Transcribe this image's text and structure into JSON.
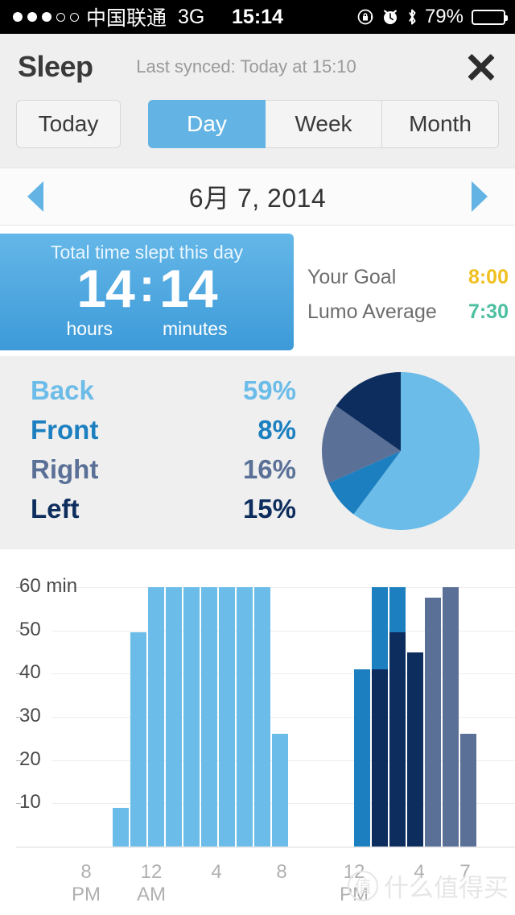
{
  "status_bar": {
    "signal_filled": 3,
    "signal_empty": 2,
    "carrier": "中国联通",
    "network": "3G",
    "time": "15:14",
    "battery_percent": "79%",
    "battery_level": 79,
    "icons": [
      "rotation-lock-icon",
      "alarm-clock-icon",
      "bluetooth-icon",
      "battery-icon"
    ]
  },
  "header": {
    "title": "Sleep",
    "last_synced": "Last synced: Today at 15:10",
    "close_label": "close-icon"
  },
  "tabs": {
    "today": "Today",
    "segments": [
      {
        "label": "Day",
        "active": true
      },
      {
        "label": "Week",
        "active": false
      },
      {
        "label": "Month",
        "active": false
      }
    ]
  },
  "date_nav": {
    "prev": "previous-day",
    "date": "6月 7, 2014",
    "next": "next-day"
  },
  "total_card": {
    "caption": "Total time slept this day",
    "hours": "14",
    "colon": ":",
    "minutes": "14",
    "hours_unit": "hours",
    "minutes_unit": "minutes"
  },
  "goals": [
    {
      "label": "Your Goal",
      "value": "8:00",
      "color": "#f0c020"
    },
    {
      "label": "Lumo Average",
      "value": "7:30",
      "color": "#4bbfa0"
    }
  ],
  "positions": [
    {
      "label": "Back",
      "value": "59%",
      "percent": 59,
      "color": "#6bbce8"
    },
    {
      "label": "Front",
      "value": "8%",
      "percent": 8,
      "color": "#1c7fc0"
    },
    {
      "label": "Right",
      "value": "16%",
      "percent": 16,
      "color": "#5a7097"
    },
    {
      "label": "Left",
      "value": "15%",
      "percent": 15,
      "color": "#0d2d5e"
    }
  ],
  "chart_data": {
    "type": "bar",
    "title": "",
    "xlabel": "",
    "ylabel": "60 min",
    "ylim": [
      0,
      63
    ],
    "yticks": [
      10,
      20,
      30,
      40,
      50,
      60
    ],
    "ytick_labels": [
      "10",
      "20",
      "30",
      "40",
      "50",
      "60 min"
    ],
    "grid": true,
    "legend_position": "none",
    "stacked": true,
    "x_tick_labels": [
      {
        "top": "8",
        "bottom": "PM"
      },
      {
        "top": "12",
        "bottom": "AM"
      },
      {
        "top": "4",
        "bottom": ""
      },
      {
        "top": "8",
        "bottom": ""
      },
      {
        "top": "12",
        "bottom": "PM"
      },
      {
        "top": "4",
        "bottom": ""
      },
      {
        "top": "7",
        "bottom": ""
      }
    ],
    "series": [
      {
        "name": "Back",
        "color": "#6bbce8"
      },
      {
        "name": "Front",
        "color": "#1c7fc0"
      },
      {
        "name": "Right",
        "color": "#5a7097"
      },
      {
        "name": "Left",
        "color": "#0d2d5e"
      }
    ],
    "bars": [
      {
        "x": 140,
        "segments": [
          {
            "series": "Back",
            "from": 0,
            "to": 9
          }
        ]
      },
      {
        "x": 162,
        "segments": [
          {
            "series": "Back",
            "from": 0,
            "to": 49.5
          }
        ]
      },
      {
        "x": 184,
        "segments": [
          {
            "series": "Back",
            "from": 0,
            "to": 60
          }
        ]
      },
      {
        "x": 206,
        "segments": [
          {
            "series": "Back",
            "from": 0,
            "to": 60
          }
        ]
      },
      {
        "x": 228,
        "segments": [
          {
            "series": "Back",
            "from": 0,
            "to": 60
          }
        ]
      },
      {
        "x": 250,
        "segments": [
          {
            "series": "Back",
            "from": 0,
            "to": 60
          }
        ]
      },
      {
        "x": 272,
        "segments": [
          {
            "series": "Back",
            "from": 0,
            "to": 60
          }
        ]
      },
      {
        "x": 294,
        "segments": [
          {
            "series": "Back",
            "from": 0,
            "to": 60
          }
        ]
      },
      {
        "x": 316,
        "segments": [
          {
            "series": "Back",
            "from": 0,
            "to": 60
          }
        ]
      },
      {
        "x": 338,
        "segments": [
          {
            "series": "Back",
            "from": 0,
            "to": 26
          }
        ]
      },
      {
        "x": 440,
        "segments": [
          {
            "series": "Front",
            "from": 0,
            "to": 41
          }
        ]
      },
      {
        "x": 462,
        "segments": [
          {
            "series": "Left",
            "from": 0,
            "to": 41
          },
          {
            "series": "Front",
            "from": 41,
            "to": 60
          }
        ]
      },
      {
        "x": 484,
        "segments": [
          {
            "series": "Left",
            "from": 0,
            "to": 49.5
          },
          {
            "series": "Front",
            "from": 49.5,
            "to": 60
          }
        ]
      },
      {
        "x": 506,
        "segments": [
          {
            "series": "Left",
            "from": 0,
            "to": 45
          }
        ]
      },
      {
        "x": 528,
        "segments": [
          {
            "series": "Right",
            "from": 0,
            "to": 57.5
          }
        ]
      },
      {
        "x": 550,
        "segments": [
          {
            "series": "Right",
            "from": 0,
            "to": 60
          }
        ]
      },
      {
        "x": 572,
        "segments": [
          {
            "series": "Right",
            "from": 0,
            "to": 26
          }
        ]
      }
    ]
  },
  "watermark": {
    "badge": "值",
    "text": "什么值得买"
  }
}
